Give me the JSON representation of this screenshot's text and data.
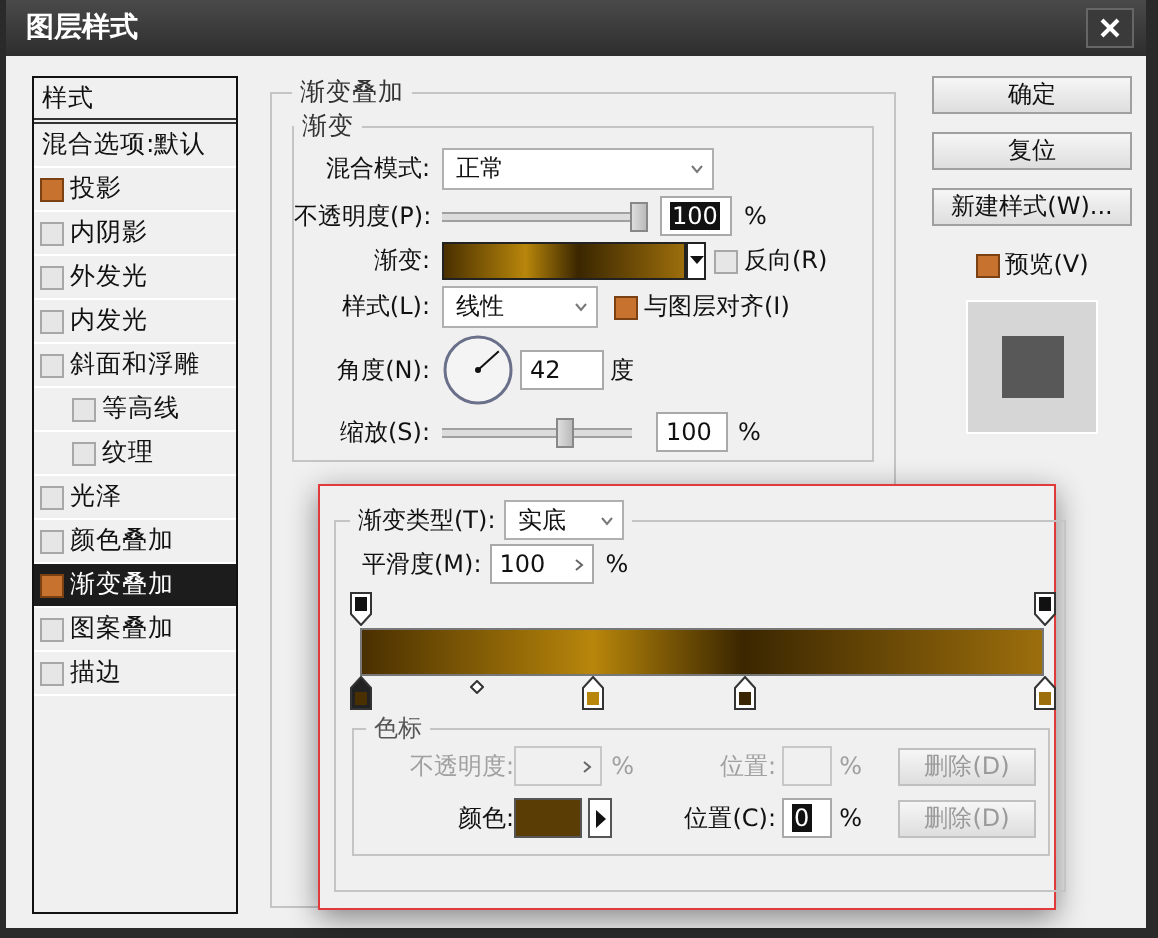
{
  "window": {
    "title": "图层样式"
  },
  "styles_list": {
    "header": "样式",
    "blend_options": "混合选项:默认",
    "items": [
      {
        "label": "投影",
        "checked": true,
        "selected": false
      },
      {
        "label": "内阴影",
        "checked": false,
        "selected": false
      },
      {
        "label": "外发光",
        "checked": false,
        "selected": false
      },
      {
        "label": "内发光",
        "checked": false,
        "selected": false
      },
      {
        "label": "斜面和浮雕",
        "checked": false,
        "selected": false,
        "children": [
          {
            "label": "等高线",
            "checked": false,
            "selected": false
          },
          {
            "label": "纹理",
            "checked": false,
            "selected": false
          }
        ]
      },
      {
        "label": "光泽",
        "checked": false,
        "selected": false
      },
      {
        "label": "颜色叠加",
        "checked": false,
        "selected": false
      },
      {
        "label": "渐变叠加",
        "checked": true,
        "selected": true
      },
      {
        "label": "图案叠加",
        "checked": false,
        "selected": false
      },
      {
        "label": "描边",
        "checked": false,
        "selected": false
      }
    ]
  },
  "gradient_overlay": {
    "title": "渐变叠加",
    "group_title": "渐变",
    "blend_mode": {
      "label": "混合模式:",
      "value": "正常"
    },
    "opacity": {
      "label": "不透明度(P):",
      "level": 1,
      "value": "100",
      "highlighted": true,
      "unit": "%"
    },
    "gradient": {
      "label": "渐变:"
    },
    "reverse": {
      "label": "反向(R)",
      "checked": false
    },
    "style": {
      "label": "样式(L):",
      "value": "线性"
    },
    "align": {
      "label": "与图层对齐(I)",
      "checked": true
    },
    "angle": {
      "label": "角度(N):",
      "value": "42",
      "unit": "度"
    },
    "scale": {
      "label": "缩放(S):",
      "level": 0.66,
      "value": "100",
      "highlighted": false,
      "unit": "%"
    }
  },
  "buttons": [
    {
      "label": "确定"
    },
    {
      "label": "复位"
    },
    {
      "label": "新建样式(W)..."
    }
  ],
  "preview": {
    "label": "预览(V)",
    "checked": true
  },
  "gradient_editor": {
    "type_label": "渐变类型(T):",
    "type_value": "实底",
    "smoothness_label": "平滑度(M):",
    "smoothness_value": "100",
    "smoothness_unit": "%",
    "opacity_stops": [
      {
        "level": 0
      },
      {
        "level": 1
      }
    ],
    "color_stops": [
      {
        "level": 0,
        "color": "#4a3000"
      },
      {
        "level": 0.34,
        "color": "#b8860b"
      },
      {
        "level": 0.56,
        "color": "#3a2600"
      },
      {
        "level": 1,
        "color": "#9c6e0c"
      }
    ],
    "midpoint": {
      "level": 0.17
    },
    "stops_title": "色标",
    "stop_rows": [
      {
        "kind": "opacity",
        "label": "不透明度:",
        "unit": "%",
        "location_label": "位置:",
        "location_unit": "%",
        "delete": "删除(D)",
        "disabled": true,
        "delete_disabled": true
      },
      {
        "kind": "color",
        "label": "颜色:",
        "color": "#5a3d05",
        "location_label": "位置(C):",
        "location_value": "0",
        "location_highlighted": true,
        "location_unit": "%",
        "delete": "删除(D)",
        "disabled": false,
        "delete_disabled": true
      }
    ]
  }
}
